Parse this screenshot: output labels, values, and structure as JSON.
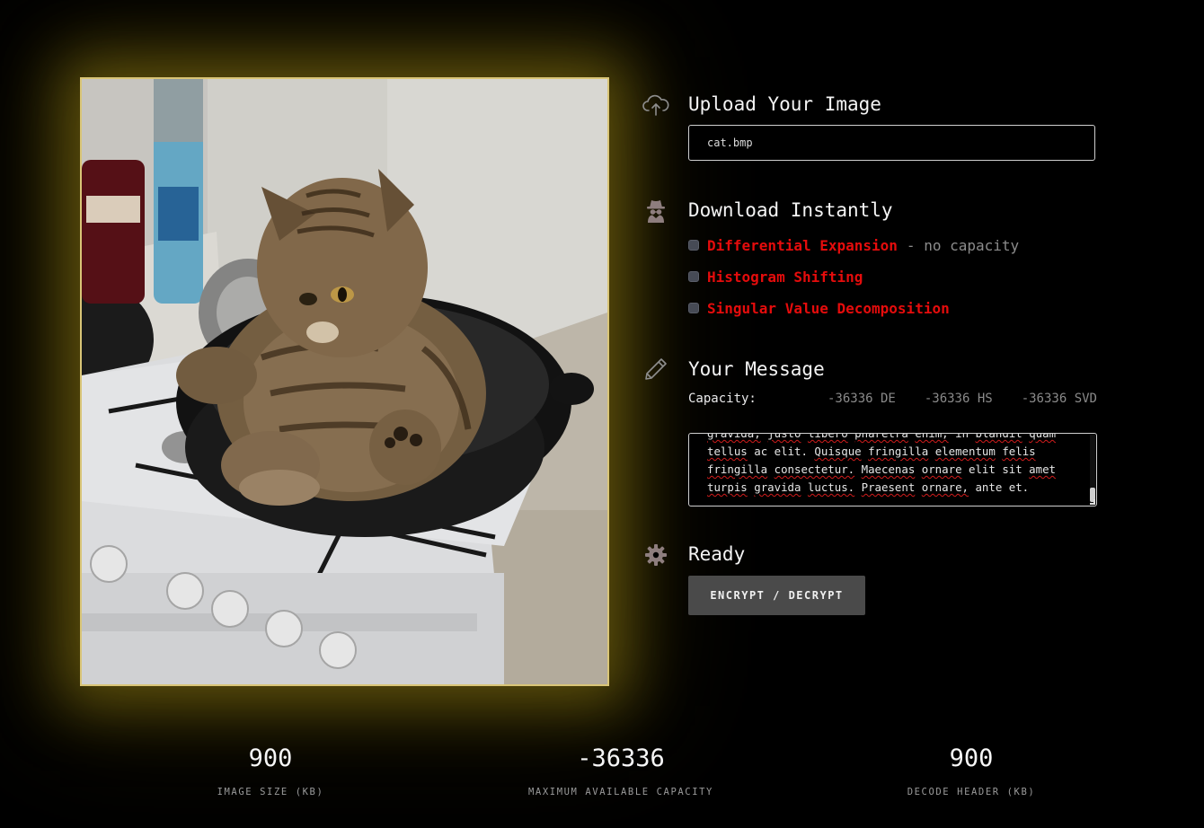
{
  "upload": {
    "title": "Upload Your Image",
    "icon": "cloud-upload-icon",
    "file_name": "cat.bmp"
  },
  "download": {
    "title": "Download Instantly",
    "icon": "spy-icon",
    "algorithms": [
      {
        "label": "Differential Expansion",
        "note": "- no capacity",
        "checked": false
      },
      {
        "label": "Histogram Shifting",
        "note": "",
        "checked": false
      },
      {
        "label": "Singular Value Decomposition",
        "note": "",
        "checked": false
      }
    ]
  },
  "message": {
    "title": "Your Message",
    "icon": "pencil-icon",
    "capacity_label": "Capacity:",
    "capacity_de": "-36336 DE",
    "capacity_hs": "-36336 HS",
    "capacity_svd": "-36336 SVD",
    "text": "gravida, justo libero pharetra enim, in blandit quam tellus ac elit. Quisque fringilla elementum felis fringilla consectetur. Maecenas ornare elit sit amet turpis gravida luctus. Praesent ornare, ante et."
  },
  "status": {
    "title": "Ready",
    "icon": "gear-icon",
    "button_label": "ENCRYPT / DECRYPT"
  },
  "stats": [
    {
      "value": "900",
      "label": "IMAGE SIZE (KB)"
    },
    {
      "value": "-36336",
      "label": "MAXIMUM AVAILABLE CAPACITY"
    },
    {
      "value": "900",
      "label": "DECODE HEADER (KB)"
    }
  ],
  "colors": {
    "background": "#000000",
    "accent_red": "#e50c0c",
    "frame_gold": "#d9c577",
    "button": "#4a4a4a"
  }
}
